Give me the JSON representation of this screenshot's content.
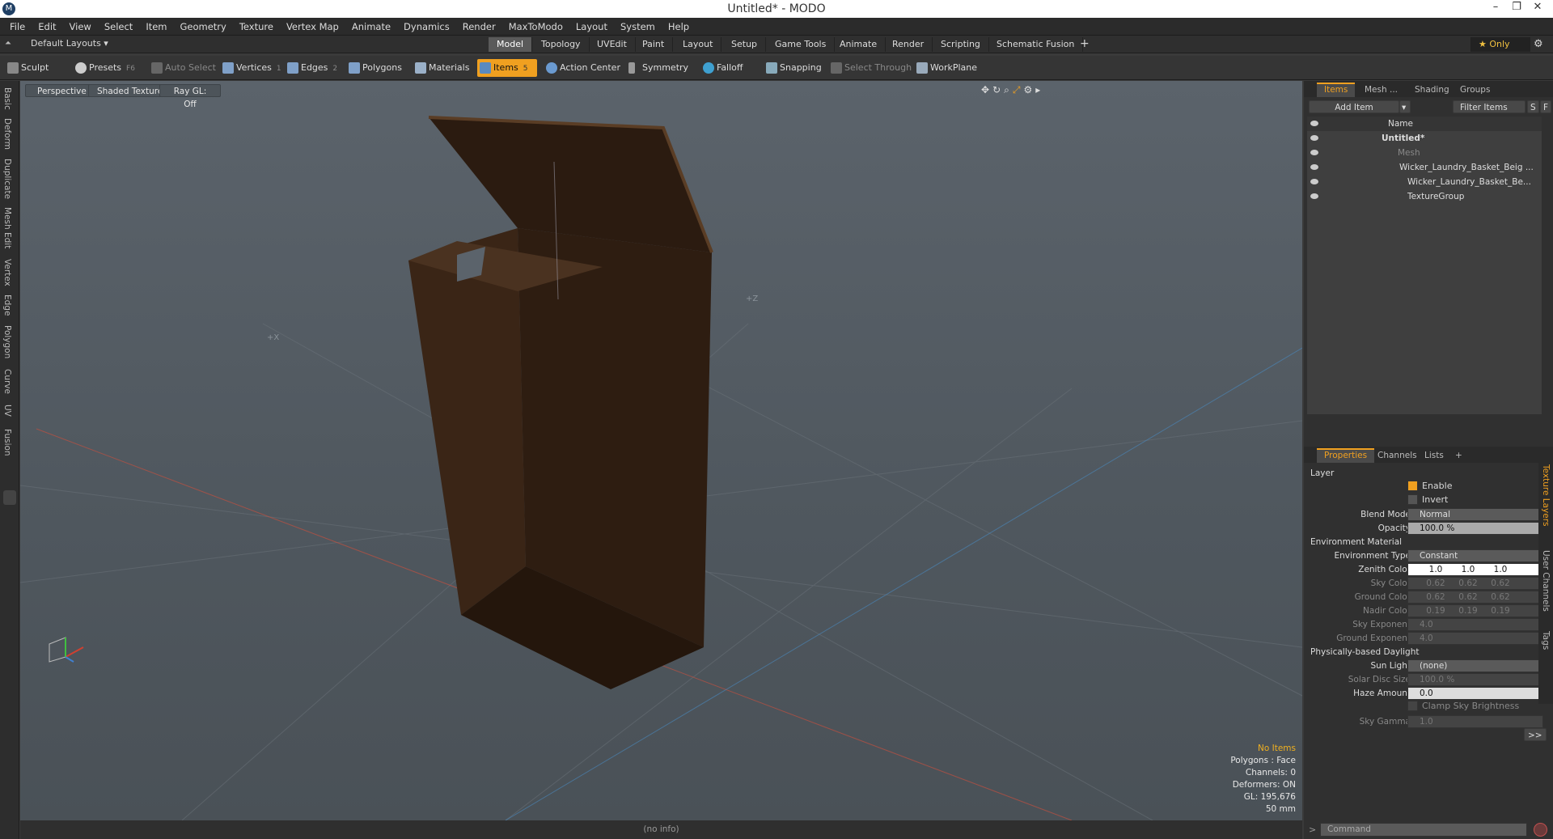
{
  "window": {
    "title": "Untitled* - MODO",
    "logo": "M",
    "min": "–",
    "restore": "❐",
    "close": "✕"
  },
  "menu": [
    "File",
    "Edit",
    "View",
    "Select",
    "Item",
    "Geometry",
    "Texture",
    "Vertex Map",
    "Animate",
    "Dynamics",
    "Render",
    "MaxToModo",
    "Layout",
    "System",
    "Help"
  ],
  "layoutbar": {
    "layouts": "Default Layouts ▾",
    "tabs": [
      "Model",
      "Topology",
      "UVEdit",
      "Paint",
      "Layout",
      "Setup",
      "Game Tools",
      "Animate",
      "Render",
      "Scripting",
      "Schematic Fusion"
    ],
    "active": "Model",
    "plus": "+",
    "only": "★  Only",
    "gear": "⚙"
  },
  "toolbar": {
    "sculpt": "Sculpt",
    "presets": "Presets",
    "presets_key": "F6",
    "auto_select": "Auto Select",
    "vertices": "Vertices",
    "vertices_key": "1",
    "edges": "Edges",
    "edges_key": "2",
    "polygons": "Polygons",
    "materials": "Materials",
    "items": "Items",
    "items_key": "5",
    "action_center": "Action Center",
    "symmetry": "Symmetry",
    "falloff": "Falloff",
    "snapping": "Snapping",
    "select_through": "Select Through",
    "workplane": "WorkPlane"
  },
  "lefttabs": [
    "Basic",
    "Deform",
    "Duplicate",
    "Mesh Edit",
    "Vertex",
    "Edge",
    "Polygon",
    "Curve",
    "UV",
    "Fusion"
  ],
  "viewport": {
    "perspective": "Perspective",
    "shading": "Shaded Texture",
    "raygl": "Ray GL: Off",
    "axis_x": "+X",
    "axis_z": "+Z",
    "status": {
      "items": "No Items",
      "polygons": "Polygons : Face",
      "channels": "Channels: 0",
      "deformers": "Deformers: ON",
      "gl": "GL: 195,676",
      "units": "50 mm"
    }
  },
  "bottom": {
    "info": "(no info)"
  },
  "items_panel": {
    "tabs": [
      "Items",
      "Mesh ...",
      "Shading",
      "Groups"
    ],
    "add_item": "Add Item",
    "filter": "Filter Items",
    "s": "S",
    "f": "F",
    "name_col": "Name",
    "rows": [
      {
        "label": "Untitled*"
      },
      {
        "label": "Mesh"
      },
      {
        "label": "Wicker_Laundry_Basket_Beig ..."
      },
      {
        "label": "Wicker_Laundry_Basket_Be..."
      },
      {
        "label": "TextureGroup"
      }
    ]
  },
  "properties": {
    "tabs": [
      "Properties",
      "Channels",
      "Lists",
      "+"
    ],
    "layer": "Layer",
    "enable": "Enable",
    "invert": "Invert",
    "blend_mode_label": "Blend Mode",
    "blend_mode": "Normal",
    "opacity_label": "Opacity",
    "opacity": "100.0 %",
    "env_material": "Environment Material",
    "env_type_label": "Environment Type",
    "env_type": "Constant",
    "zenith_label": "Zenith Color",
    "zenith": [
      "1.0",
      "1.0",
      "1.0"
    ],
    "sky_label": "Sky Color",
    "sky": [
      "0.62",
      "0.62",
      "0.62"
    ],
    "ground_label": "Ground Color",
    "ground": [
      "0.62",
      "0.62",
      "0.62"
    ],
    "nadir_label": "Nadir Color",
    "nadir": [
      "0.19",
      "0.19",
      "0.19"
    ],
    "sky_exp_label": "Sky Exponent",
    "sky_exp": "4.0",
    "ground_exp_label": "Ground Exponent",
    "ground_exp": "4.0",
    "daylight": "Physically-based Daylight",
    "sunlight_label": "Sun Light",
    "sunlight": "(none)",
    "disc_label": "Solar Disc Size",
    "disc": "100.0 %",
    "haze_label": "Haze Amount",
    "haze": "0.0",
    "clamp": "Clamp Sky Brightness",
    "gamma_label": "Sky Gamma",
    "gamma": "1.0",
    "more": ">>",
    "side_tabs": [
      "Texture Layers",
      "User Channels",
      "Tags"
    ]
  },
  "command": {
    "placeholder": "Command",
    "prompt": ">"
  }
}
